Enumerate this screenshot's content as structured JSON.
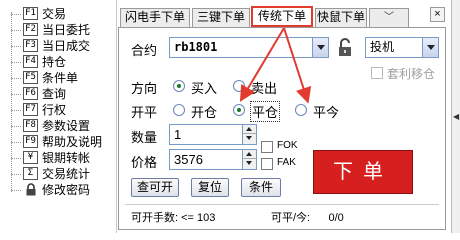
{
  "tree": {
    "items": [
      {
        "key": "F1",
        "label": "交易"
      },
      {
        "key": "F2",
        "label": "当日委托"
      },
      {
        "key": "F3",
        "label": "当日成交"
      },
      {
        "key": "F4",
        "label": "持仓"
      },
      {
        "key": "F5",
        "label": "条件单"
      },
      {
        "key": "F6",
        "label": "查询"
      },
      {
        "key": "F7",
        "label": "行权"
      },
      {
        "key": "F8",
        "label": "参数设置"
      },
      {
        "key": "F9",
        "label": "帮助及说明"
      },
      {
        "key": "¥",
        "label": "银期转帐"
      },
      {
        "key": "Σ",
        "label": "交易统计"
      },
      {
        "key": "lock",
        "label": "修改密码"
      }
    ]
  },
  "tabs": [
    {
      "label": "闪电手下单"
    },
    {
      "label": "三键下单"
    },
    {
      "label": "传统下单"
    },
    {
      "label": "快鼠下单"
    },
    {
      "label": "more",
      "icon": "double-chevron-down-icon"
    }
  ],
  "close_label": "×",
  "form": {
    "contract_label": "合约",
    "contract_value": "rb1801",
    "hedge_value": "投机",
    "arbitrage_label": "套利移仓",
    "direction_label": "方向",
    "buy_label": "买入",
    "sell_label": "卖出",
    "offset_label": "开平",
    "open_label": "开仓",
    "close_pos_label": "平仓",
    "close_today_label": "平今",
    "qty_label": "数量",
    "qty_value": "1",
    "price_label": "价格",
    "price_value": "3576",
    "fok_label": "FOK",
    "fak_label": "FAK",
    "check_open_label": "查可开",
    "reset_label": "复位",
    "condition_label": "条件",
    "order_label": "下单",
    "open_qty_status": "可开手数: <= 103",
    "close_qty_status": "可平/今:      0/0"
  },
  "colors": {
    "highlight": "#e23a2e",
    "order_button": "#d62020"
  }
}
